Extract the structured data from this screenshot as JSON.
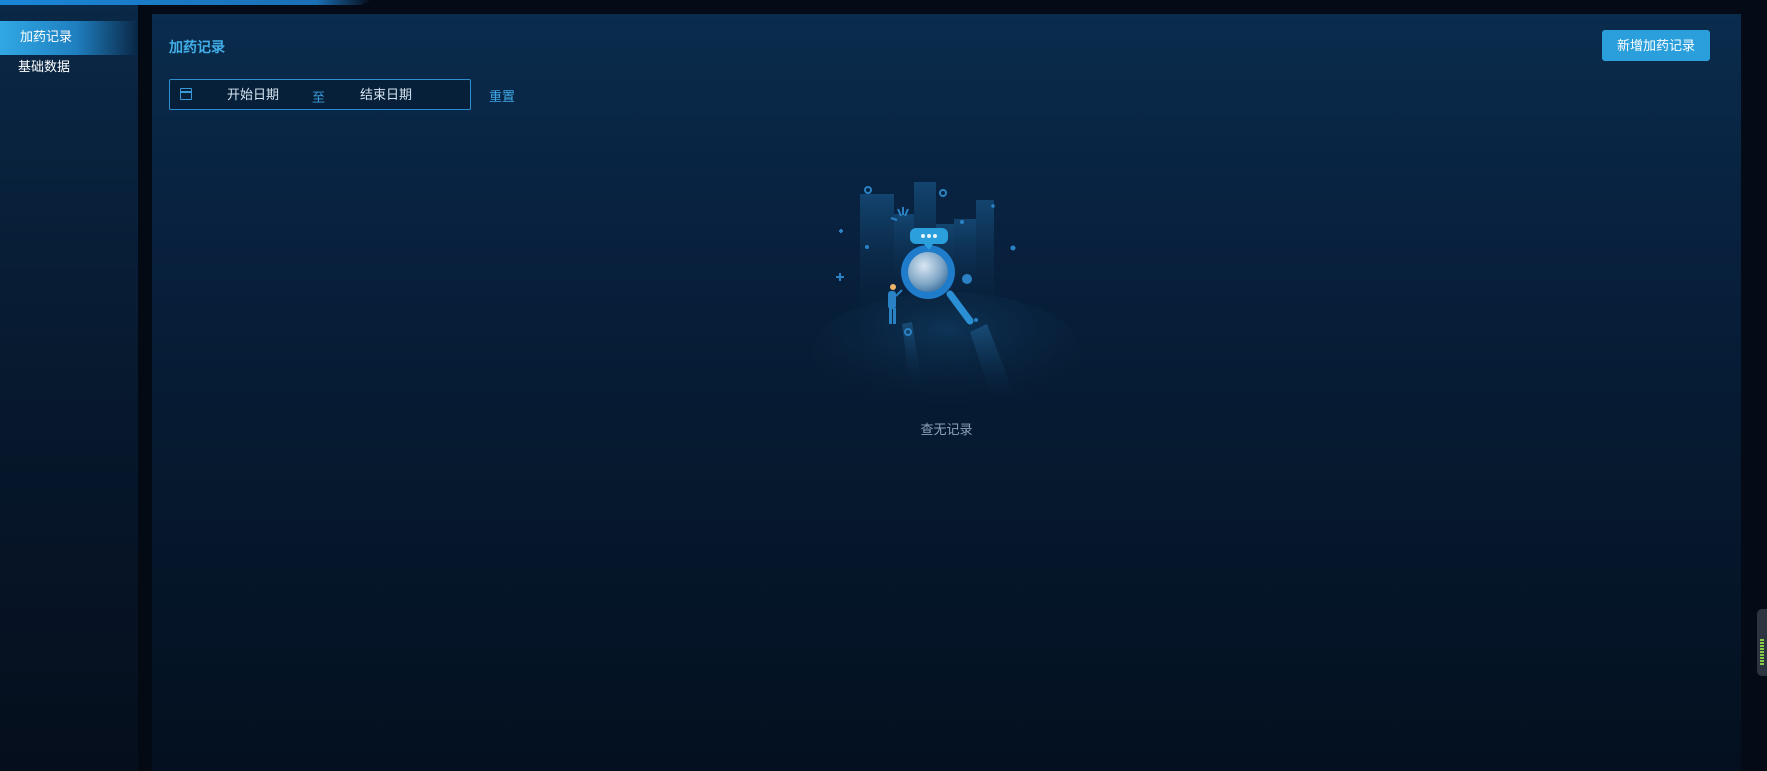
{
  "sidebar": {
    "items": [
      {
        "label": "加药记录",
        "active": true
      },
      {
        "label": "基础数据",
        "active": false
      }
    ]
  },
  "main": {
    "title": "加药记录",
    "add_button_label": "新增加药记录",
    "date_filter": {
      "start_placeholder": "开始日期",
      "separator": "至",
      "end_placeholder": "结束日期"
    },
    "reset_label": "重置",
    "empty_text": "查无记录"
  },
  "colors": {
    "accent": "#2a9fdc",
    "title": "#42aee8",
    "background": "#050b16"
  },
  "icons": {
    "date_icon": "calendar-icon",
    "empty_illustration": "magnifier-search-illustration"
  }
}
